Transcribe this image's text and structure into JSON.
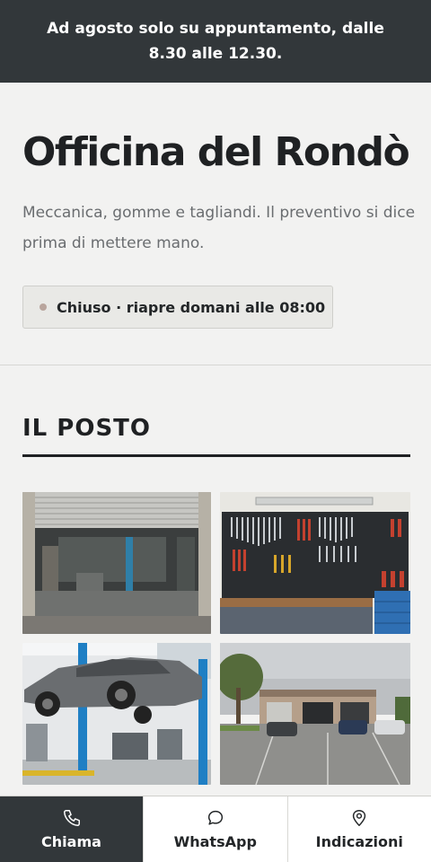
{
  "announcement": "Ad agosto solo su appuntamento, dalle 8.30 alle 12.30.",
  "hero": {
    "title": "Officina del Rondò",
    "subtitle": "Meccanica, gomme e tagliandi. Il preventivo si dice prima di mettere mano.",
    "status": "Chiuso · riapre domani alle 08:00"
  },
  "section": {
    "title": "IL POSTO"
  },
  "photos": [
    {
      "icon": "garage-door-photo"
    },
    {
      "icon": "tool-wall-photo"
    },
    {
      "icon": "car-lift-photo"
    },
    {
      "icon": "workshop-exterior-photo"
    }
  ],
  "nav": {
    "call_label": "Chiama",
    "whatsapp_label": "WhatsApp",
    "directions_label": "Indicazioni"
  },
  "colors": {
    "dark": "#32373a",
    "background": "#f2f2f1",
    "status_dot": "#b9a59d"
  }
}
